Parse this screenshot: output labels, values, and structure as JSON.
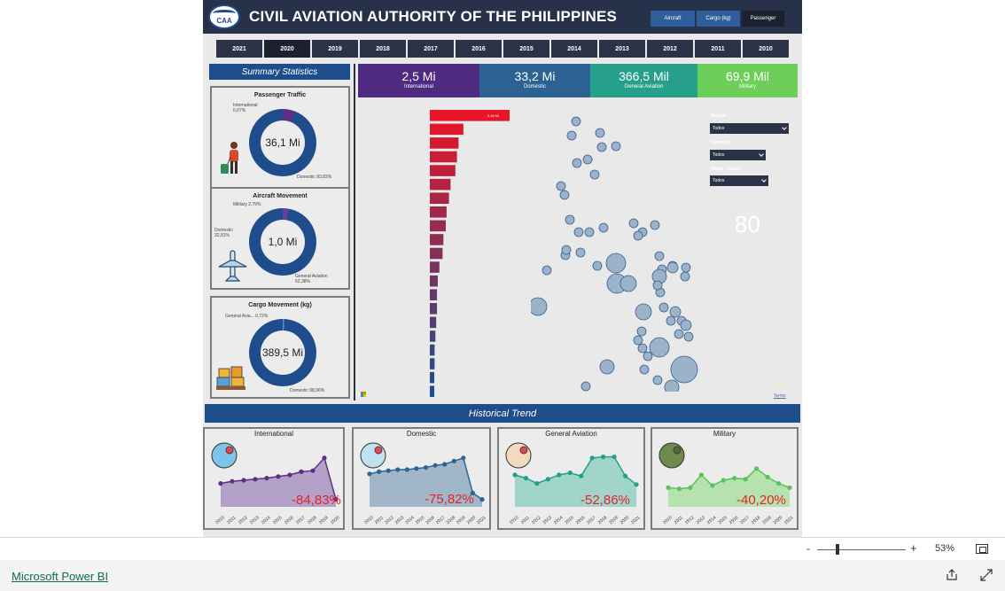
{
  "header": {
    "title": "CIVIL AVIATION AUTHORITY OF THE PHILIPPINES",
    "logo_text": "CAA",
    "tabs": [
      {
        "label": "Aircraft",
        "color": "#2e5f9c"
      },
      {
        "label": "Cargo (kg)",
        "color": "#2e5f9c"
      },
      {
        "label": "Passenger",
        "color": "#1c2130"
      }
    ]
  },
  "years": [
    "2021",
    "2020",
    "2019",
    "2018",
    "2017",
    "2016",
    "2015",
    "2014",
    "2013",
    "2012",
    "2011",
    "2010"
  ],
  "selected_year": "2020",
  "summary": {
    "title": "Summary Statistics",
    "cards": [
      {
        "title": "Passenger Traffic",
        "center": "36,1 Mi",
        "labels": [
          "International 6,07%",
          "Domestic 93,82%"
        ],
        "slices": [
          {
            "name": "International",
            "pct": 6.07,
            "color": "#5e2f84"
          },
          {
            "name": "Domestic",
            "pct": 93.82,
            "color": "#1f4d8c"
          }
        ],
        "icon": "traveler-icon"
      },
      {
        "title": "Aircraft Movement",
        "center": "1,0 Mi",
        "labels": [
          "Military 2,79%",
          "Domestic 32,81%",
          "General Aviation 62,38%"
        ],
        "slices": [
          {
            "name": "Military",
            "pct": 2.79,
            "color": "#6a3d9a"
          },
          {
            "name": "Domestic",
            "pct": 32.81,
            "color": "#1f4d8c"
          },
          {
            "name": "General Aviation",
            "pct": 62.38,
            "color": "#1f4d8c"
          }
        ],
        "icon": "airplane-icon"
      },
      {
        "title": "Cargo Movement (kg)",
        "center": "389,5 Mi",
        "labels": [
          "General Avia... 0,72%",
          "Domestic 98,96%"
        ],
        "slices": [
          {
            "name": "General Aviation",
            "pct": 0.72,
            "color": "#5e8fc8"
          },
          {
            "name": "Domestic",
            "pct": 98.96,
            "color": "#1f4d8c"
          }
        ],
        "icon": "cargo-icon"
      }
    ]
  },
  "kpis": [
    {
      "value": "2,5 Mi",
      "label": "International",
      "color": "#4e2a80"
    },
    {
      "value": "33,2 Mi",
      "label": "Domestic",
      "color": "#2c6293"
    },
    {
      "value": "366,5 Mil",
      "label": "General Aviation",
      "color": "#26a08a"
    },
    {
      "value": "69,9 Mil",
      "label": "Military",
      "color": "#6ccf5a"
    }
  ],
  "bar_ranking": {
    "top_label": "5,48 Mi",
    "values": [
      100,
      42,
      36,
      34,
      32,
      26,
      24,
      21,
      20,
      17,
      16,
      12,
      10,
      9,
      9,
      8,
      7,
      6,
      6,
      5,
      5
    ]
  },
  "filters": [
    {
      "label": "Region",
      "value": "Todos"
    },
    {
      "label": "Operation",
      "value": "Todos"
    },
    {
      "label": "Flight - Status",
      "value": "Todos"
    }
  ],
  "map_count": "80",
  "terms_label": "Terms",
  "history": {
    "title": "Historical Trend",
    "cards": [
      {
        "title": "International",
        "change": "-84,83%",
        "color": "#5e2f84",
        "fill": "#a58fbf",
        "icon": "globe-pins-icon",
        "years": [
          "2010",
          "2011",
          "2012",
          "2013",
          "2014",
          "2015",
          "2016",
          "2017",
          "2018",
          "2019",
          "2020"
        ],
        "values": [
          44,
          48,
          50,
          52,
          54,
          57,
          60,
          66,
          68,
          92,
          14
        ]
      },
      {
        "title": "Domestic",
        "change": "-75,82%",
        "color": "#2e6593",
        "fill": "#8fa9bf",
        "icon": "map-pin-icon",
        "years": [
          "2010",
          "2011",
          "2012",
          "2013",
          "2014",
          "2015",
          "2016",
          "2017",
          "2018",
          "2019",
          "2020",
          "2021"
        ],
        "values": [
          62,
          66,
          68,
          70,
          70,
          72,
          74,
          78,
          80,
          86,
          92,
          26,
          14
        ]
      },
      {
        "title": "General Aviation",
        "change": "-52,86%",
        "color": "#22a08a",
        "fill": "#8ecfc2",
        "icon": "pilot-icon",
        "years": [
          "2010",
          "2011",
          "2012",
          "2013",
          "2014",
          "2015",
          "2016",
          "2017",
          "2018",
          "2019",
          "2020",
          "2021"
        ],
        "values": [
          60,
          54,
          44,
          52,
          60,
          64,
          58,
          92,
          94,
          94,
          58,
          42
        ]
      },
      {
        "title": "Military",
        "change": "-40,20%",
        "color": "#5cc25a",
        "fill": "#a9e0a0",
        "icon": "soldier-icon",
        "years": [
          "2010",
          "2011",
          "2012",
          "2013",
          "2014",
          "2015",
          "2016",
          "2017",
          "2018",
          "2019",
          "2020",
          "2021"
        ],
        "values": [
          36,
          34,
          36,
          60,
          40,
          50,
          54,
          52,
          72,
          56,
          44,
          36
        ]
      }
    ]
  },
  "footer": {
    "zoom_minus": "-",
    "zoom_plus": "+",
    "zoom": "53%",
    "link": "Microsoft Power BI"
  }
}
